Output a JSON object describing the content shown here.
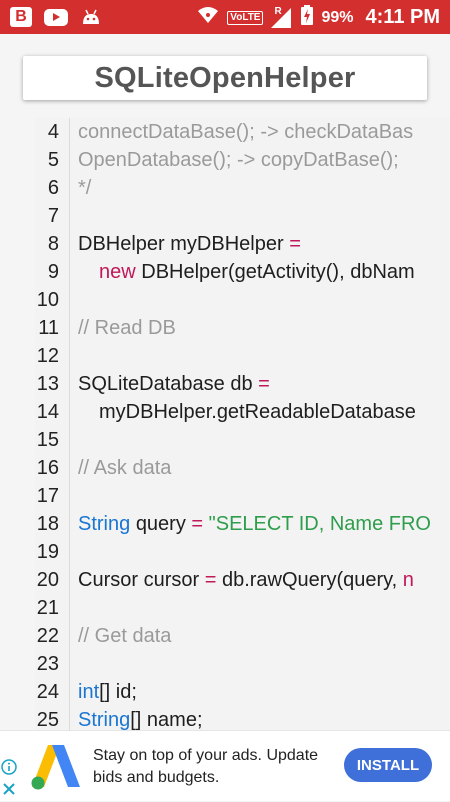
{
  "status_bar": {
    "battery_percent": "99%",
    "time": "4:11 PM",
    "network_badge": "VoLTE",
    "roaming_label": "R",
    "icons": [
      "blogger-icon",
      "youtube-icon",
      "android-icon",
      "wifi-icon",
      "signal-icon",
      "battery-icon"
    ]
  },
  "header": {
    "title": "SQLiteOpenHelper"
  },
  "code": {
    "lines": [
      {
        "num": "4"
      },
      {
        "num": "5"
      },
      {
        "num": "6"
      },
      {
        "num": "7"
      },
      {
        "num": "8"
      },
      {
        "num": "9"
      },
      {
        "num": "10"
      },
      {
        "num": "11"
      },
      {
        "num": "12"
      },
      {
        "num": "13"
      },
      {
        "num": "14"
      },
      {
        "num": "15"
      },
      {
        "num": "16"
      },
      {
        "num": "17"
      },
      {
        "num": "18"
      },
      {
        "num": "19"
      },
      {
        "num": "20"
      },
      {
        "num": "21"
      },
      {
        "num": "22"
      },
      {
        "num": "23"
      },
      {
        "num": "24"
      },
      {
        "num": "25"
      }
    ],
    "l4": "connectDataBase(); -> checkDataBas",
    "l5": "OpenDatabase(); -> copyDatBase();",
    "l6": "*/",
    "l8_a": "DBHelper myDBHelper",
    "l8_b": "=",
    "l9_a": "new",
    "l9_b": "DBHelper(getActivity(), dbNam",
    "l11": "// Read DB",
    "l13_a": "SQLiteDatabase db",
    "l13_b": "=",
    "l14": "myDBHelper.getReadableDatabase",
    "l16": "// Ask data",
    "l18_a": "String",
    "l18_b": "query",
    "l18_c": "=",
    "l18_d": "\"SELECT ID, Name  FRO",
    "l20_a": "Cursor cursor",
    "l20_b": "=",
    "l20_c": "db.rawQuery(query,",
    "l20_d": "n",
    "l22": "// Get data",
    "l24_a": "int",
    "l24_b": "[] id;",
    "l25_a": "String",
    "l25_b": "[] name;"
  },
  "ad": {
    "text": "Stay on top of your ads. Update bids and budgets.",
    "button_label": "INSTALL",
    "colors": {
      "button": "#3f6fd8"
    }
  },
  "colors": {
    "status_bar": "#d32f2f",
    "keyword_pink": "#c0185a",
    "keyword_blue": "#1976d2",
    "string_green": "#2e9d4c",
    "comment_gray": "#9a9a9a"
  }
}
